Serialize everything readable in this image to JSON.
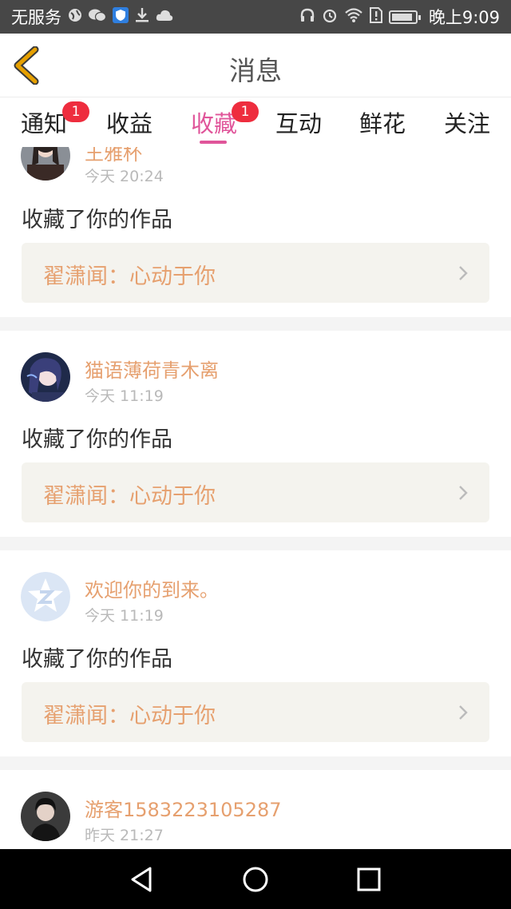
{
  "status_bar": {
    "carrier": "无服务",
    "time": "晚上9:09",
    "battery_level": 0.9
  },
  "header": {
    "title": "消息"
  },
  "tabs": [
    {
      "label": "通知",
      "badge": "1",
      "active": false
    },
    {
      "label": "收益",
      "badge": "",
      "active": false
    },
    {
      "label": "收藏",
      "badge": "1",
      "active": true
    },
    {
      "label": "互动",
      "badge": "",
      "active": false
    },
    {
      "label": "鲜花",
      "badge": "",
      "active": false
    },
    {
      "label": "关注",
      "badge": "",
      "active": false
    }
  ],
  "feed": [
    {
      "username": "王雅杯",
      "time": "今天 20:24",
      "action": "收藏了你的作品",
      "work_title": "翟潇闻：心动于你"
    },
    {
      "username": "猫语薄荷青木离",
      "time": "今天 11:19",
      "action": "收藏了你的作品",
      "work_title": "翟潇闻：心动于你"
    },
    {
      "username": "欢迎你的到来。",
      "time": "今天 11:19",
      "action": "收藏了你的作品",
      "work_title": "翟潇闻：心动于你"
    },
    {
      "username": "游客1583223105287",
      "time": "昨天 21:27"
    }
  ],
  "colors": {
    "accent": "#e0559a",
    "username": "#e6a06f",
    "badge": "#ee2d3e",
    "back_arrow": "#e6a000"
  }
}
